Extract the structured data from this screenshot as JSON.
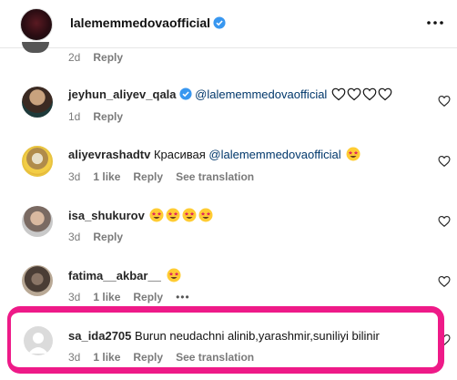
{
  "header": {
    "username": "lalememmedovaofficial",
    "verified": true,
    "more_icon": "more-horizontal-icon"
  },
  "prev_comment": {
    "time": "2d",
    "reply": "Reply"
  },
  "comments": [
    {
      "username": "jeyhun_aliyev_qala",
      "verified": true,
      "mention": "@lalememmedovaofficial",
      "text": "",
      "emoji": "four-outline-hearts",
      "time": "1d",
      "likes": "",
      "reply": "Reply",
      "see_translation": ""
    },
    {
      "username": "aliyevrashadtv",
      "verified": false,
      "text": "Красивая",
      "mention": "@lalememmedovaofficial",
      "emoji": "star-struck-face",
      "time": "3d",
      "likes": "1 like",
      "reply": "Reply",
      "see_translation": "See translation"
    },
    {
      "username": "isa_shukurov",
      "verified": false,
      "text": "",
      "emoji": "four-star-struck-faces",
      "time": "3d",
      "likes": "",
      "reply": "Reply",
      "see_translation": ""
    },
    {
      "username": "fatima__akbar__",
      "verified": false,
      "text": "",
      "emoji": "star-struck-face",
      "time": "3d",
      "likes": "1 like",
      "reply": "Reply",
      "see_translation": "",
      "more": "•••"
    },
    {
      "username": "sa_ida2705",
      "verified": false,
      "text": "Burun neudachni alinib,yarashmir,suniliyi bilinir",
      "time": "3d",
      "likes": "1 like",
      "reply": "Reply",
      "see_translation": "See translation"
    }
  ],
  "colors": {
    "annotation": "#ee1a88",
    "verified": "#3897f0",
    "mention": "#00376b",
    "meta": "#7a7a7a"
  }
}
